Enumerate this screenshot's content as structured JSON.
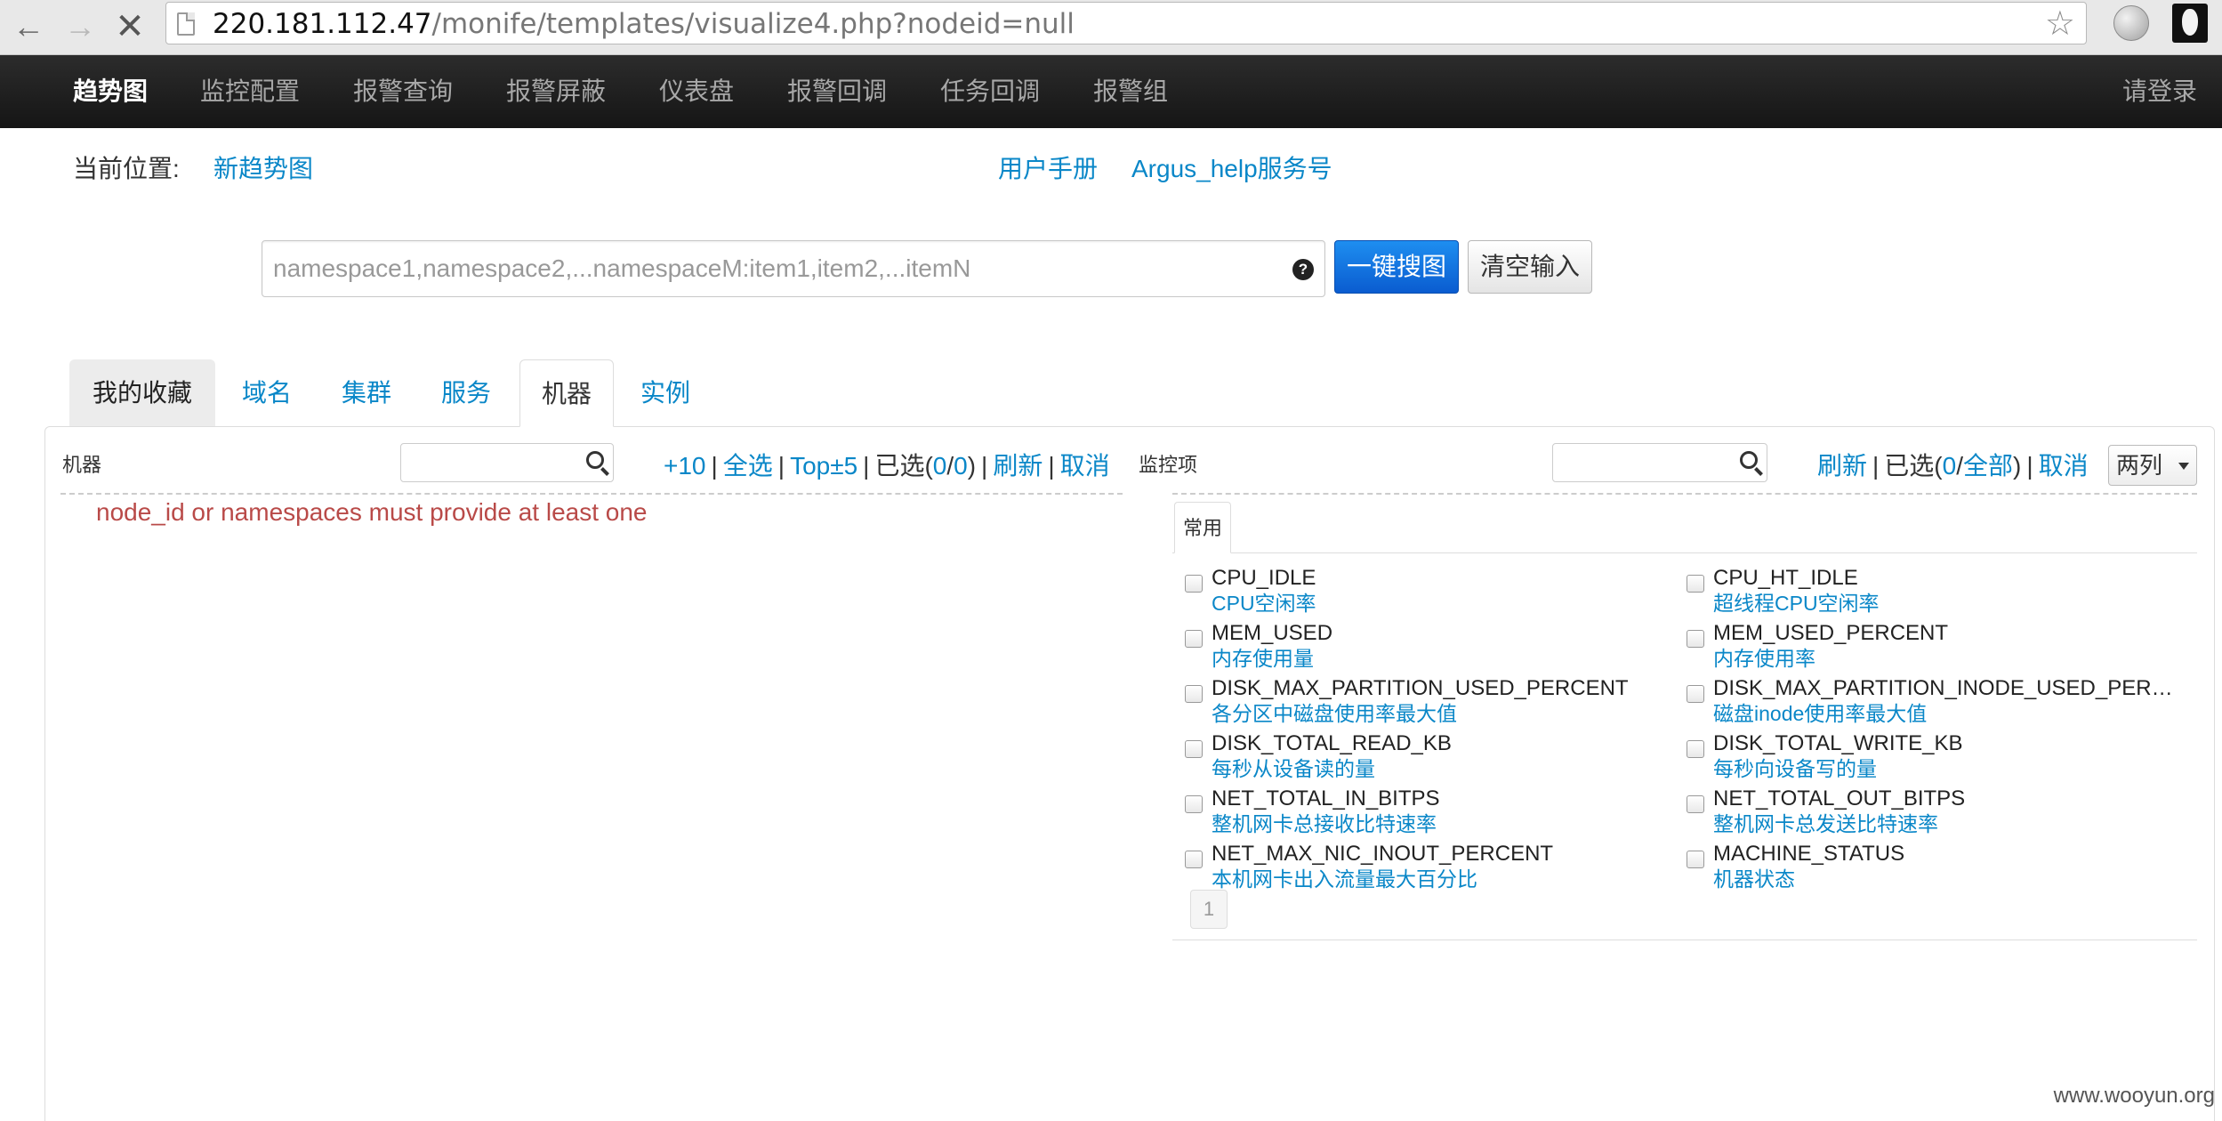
{
  "browser": {
    "url_host": "220.181.112.47",
    "url_path": "/monife/templates/visualize4.php?nodeid=null"
  },
  "navbar": {
    "items": [
      {
        "label": "趋势图"
      },
      {
        "label": "监控配置"
      },
      {
        "label": "报警查询"
      },
      {
        "label": "报警屏蔽"
      },
      {
        "label": "仪表盘"
      },
      {
        "label": "报警回调"
      },
      {
        "label": "任务回调"
      },
      {
        "label": "报警组"
      }
    ],
    "login": "请登录"
  },
  "breadcrumb": {
    "label": "当前位置:",
    "current": "新趋势图"
  },
  "help_links": {
    "manual": "用户手册",
    "service": "Argus_help服务号"
  },
  "search": {
    "placeholder": "namespace1,namespace2,...namespaceM:item1,item2,...itemN",
    "search_button": "一键搜图",
    "clear_button": "清空输入"
  },
  "tabs": [
    {
      "label": "我的收藏"
    },
    {
      "label": "域名"
    },
    {
      "label": "集群"
    },
    {
      "label": "服务"
    },
    {
      "label": "机器"
    },
    {
      "label": "实例"
    }
  ],
  "left_pane": {
    "title": "机器",
    "actions": {
      "plus10": "+10",
      "select_all": "全选",
      "top5": "Top±5",
      "selected_prefix": "已选(",
      "selected_count": "0",
      "slash": "/",
      "total": "0",
      "selected_suffix": ")",
      "refresh": "刷新",
      "cancel": "取消"
    },
    "error": "node_id or namespaces must provide at least one"
  },
  "right_pane": {
    "title": "监控项",
    "actions": {
      "refresh": "刷新",
      "selected_prefix": "已选(",
      "selected_count": "0",
      "slash": "/",
      "total": "全部",
      "selected_suffix": ")",
      "cancel": "取消"
    },
    "columns_select": "两列",
    "sub_tab": "常用",
    "metrics": [
      {
        "name": "CPU_IDLE",
        "desc": "CPU空闲率"
      },
      {
        "name": "CPU_HT_IDLE",
        "desc": "超线程CPU空闲率"
      },
      {
        "name": "MEM_USED",
        "desc": "内存使用量"
      },
      {
        "name": "MEM_USED_PERCENT",
        "desc": "内存使用率"
      },
      {
        "name": "DISK_MAX_PARTITION_USED_PERCENT",
        "desc": "各分区中磁盘使用率最大值"
      },
      {
        "name": "DISK_MAX_PARTITION_INODE_USED_PERCE...",
        "desc": "磁盘inode使用率最大值"
      },
      {
        "name": "DISK_TOTAL_READ_KB",
        "desc": "每秒从设备读的量"
      },
      {
        "name": "DISK_TOTAL_WRITE_KB",
        "desc": "每秒向设备写的量"
      },
      {
        "name": "NET_TOTAL_IN_BITPS",
        "desc": "整机网卡总接收比特速率"
      },
      {
        "name": "NET_TOTAL_OUT_BITPS",
        "desc": "整机网卡总发送比特速率"
      },
      {
        "name": "NET_MAX_NIC_INOUT_PERCENT",
        "desc": "本机网卡出入流量最大百分比"
      },
      {
        "name": "MACHINE_STATUS",
        "desc": "机器状态"
      }
    ],
    "page": "1"
  },
  "watermark": "www.wooyun.org"
}
